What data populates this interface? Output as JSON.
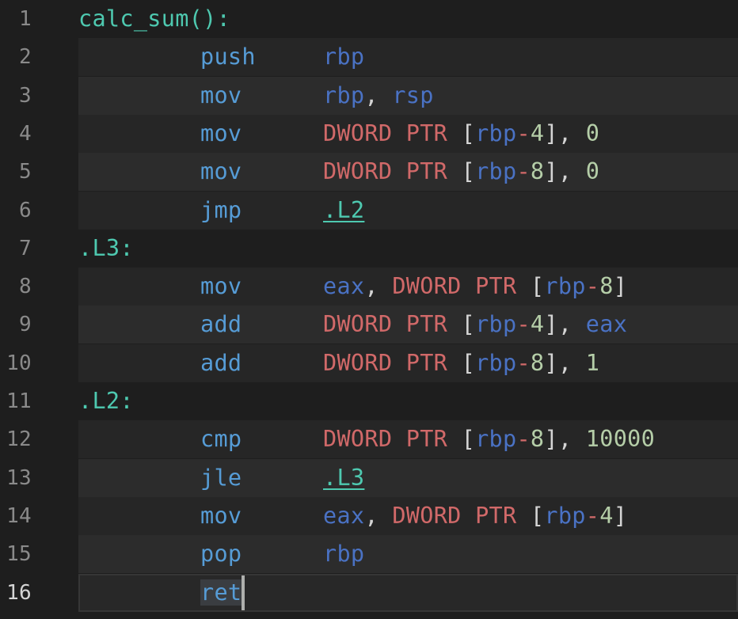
{
  "editor": {
    "lines": [
      {
        "n": "1",
        "label": "calc_sum():"
      },
      {
        "n": "2",
        "mnemonic": "push",
        "ops": [
          {
            "t": "rbp",
            "c": "reg"
          }
        ]
      },
      {
        "n": "3",
        "mnemonic": "mov",
        "ops": [
          {
            "t": "rbp",
            "c": "reg"
          },
          {
            "t": ", ",
            "c": "op"
          },
          {
            "t": "rsp",
            "c": "reg"
          }
        ]
      },
      {
        "n": "4",
        "mnemonic": "mov",
        "ops": [
          {
            "t": "DWORD PTR",
            "c": "kw"
          },
          {
            "t": " [",
            "c": "op"
          },
          {
            "t": "rbp",
            "c": "reg"
          },
          {
            "t": "-",
            "c": "kw"
          },
          {
            "t": "4",
            "c": "num"
          },
          {
            "t": "], ",
            "c": "op"
          },
          {
            "t": "0",
            "c": "num"
          }
        ]
      },
      {
        "n": "5",
        "mnemonic": "mov",
        "ops": [
          {
            "t": "DWORD PTR",
            "c": "kw"
          },
          {
            "t": " [",
            "c": "op"
          },
          {
            "t": "rbp",
            "c": "reg"
          },
          {
            "t": "-",
            "c": "kw"
          },
          {
            "t": "8",
            "c": "num"
          },
          {
            "t": "], ",
            "c": "op"
          },
          {
            "t": "0",
            "c": "num"
          }
        ]
      },
      {
        "n": "6",
        "mnemonic": "jmp",
        "ops": [
          {
            "t": ".L2",
            "c": "ref"
          }
        ]
      },
      {
        "n": "7",
        "label": ".L3:"
      },
      {
        "n": "8",
        "mnemonic": "mov",
        "ops": [
          {
            "t": "eax",
            "c": "reg"
          },
          {
            "t": ", ",
            "c": "op"
          },
          {
            "t": "DWORD PTR",
            "c": "kw"
          },
          {
            "t": " [",
            "c": "op"
          },
          {
            "t": "rbp",
            "c": "reg"
          },
          {
            "t": "-",
            "c": "kw"
          },
          {
            "t": "8",
            "c": "num"
          },
          {
            "t": "]",
            "c": "op"
          }
        ]
      },
      {
        "n": "9",
        "mnemonic": "add",
        "ops": [
          {
            "t": "DWORD PTR",
            "c": "kw"
          },
          {
            "t": " [",
            "c": "op"
          },
          {
            "t": "rbp",
            "c": "reg"
          },
          {
            "t": "-",
            "c": "kw"
          },
          {
            "t": "4",
            "c": "num"
          },
          {
            "t": "], ",
            "c": "op"
          },
          {
            "t": "eax",
            "c": "reg"
          }
        ]
      },
      {
        "n": "10",
        "mnemonic": "add",
        "ops": [
          {
            "t": "DWORD PTR",
            "c": "kw"
          },
          {
            "t": " [",
            "c": "op"
          },
          {
            "t": "rbp",
            "c": "reg"
          },
          {
            "t": "-",
            "c": "kw"
          },
          {
            "t": "8",
            "c": "num"
          },
          {
            "t": "], ",
            "c": "op"
          },
          {
            "t": "1",
            "c": "num"
          }
        ]
      },
      {
        "n": "11",
        "label": ".L2:"
      },
      {
        "n": "12",
        "mnemonic": "cmp",
        "ops": [
          {
            "t": "DWORD PTR",
            "c": "kw"
          },
          {
            "t": " [",
            "c": "op"
          },
          {
            "t": "rbp",
            "c": "reg"
          },
          {
            "t": "-",
            "c": "kw"
          },
          {
            "t": "8",
            "c": "num"
          },
          {
            "t": "], ",
            "c": "op"
          },
          {
            "t": "10000",
            "c": "num"
          }
        ]
      },
      {
        "n": "13",
        "mnemonic": "jle",
        "ops": [
          {
            "t": ".L3",
            "c": "ref"
          }
        ]
      },
      {
        "n": "14",
        "mnemonic": "mov",
        "ops": [
          {
            "t": "eax",
            "c": "reg"
          },
          {
            "t": ", ",
            "c": "op"
          },
          {
            "t": "DWORD PTR",
            "c": "kw"
          },
          {
            "t": " [",
            "c": "op"
          },
          {
            "t": "rbp",
            "c": "reg"
          },
          {
            "t": "-",
            "c": "kw"
          },
          {
            "t": "4",
            "c": "num"
          },
          {
            "t": "]",
            "c": "op"
          }
        ]
      },
      {
        "n": "15",
        "mnemonic": "pop",
        "ops": [
          {
            "t": "rbp",
            "c": "reg"
          }
        ]
      },
      {
        "n": "16",
        "mnemonic": "ret",
        "current": true
      }
    ]
  }
}
